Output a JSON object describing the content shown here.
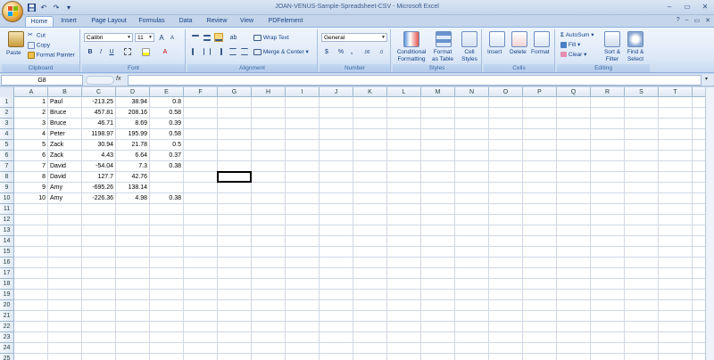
{
  "window": {
    "title": "JOAN-VENUS-Sample-Spreadsheet-CSV - Microsoft Excel",
    "minimize": "–",
    "restore": "▭",
    "close": "✕"
  },
  "qat": {
    "save_icon": "save-icon",
    "undo": "↶",
    "redo": "↷",
    "customize": "▾"
  },
  "tabs": [
    "Home",
    "Insert",
    "Page Layout",
    "Formulas",
    "Data",
    "Review",
    "View",
    "PDFelement"
  ],
  "active_tab": "Home",
  "ribbon": {
    "clipboard": {
      "paste": "Paste",
      "cut": "Cut",
      "copy": "Copy",
      "format_painter": "Format Painter",
      "label": "Clipboard"
    },
    "font": {
      "name": "Calibri",
      "size": "11",
      "grow": "A",
      "shrink": "A",
      "bold": "B",
      "italic": "I",
      "underline": "U",
      "font_color_glyph": "A",
      "label": "Font"
    },
    "alignment": {
      "wrap_text": "Wrap Text",
      "merge_center": "Merge & Center",
      "label": "Alignment"
    },
    "number": {
      "format": "General",
      "currency": "$",
      "percent": "%",
      "comma": ",",
      "inc_decimal": ".00",
      "dec_decimal": ".0",
      "label": "Number"
    },
    "styles": {
      "conditional_1": "Conditional",
      "conditional_2": "Formatting",
      "format_table_1": "Format",
      "format_table_2": "as Table",
      "cell_styles_1": "Cell",
      "cell_styles_2": "Styles",
      "label": "Styles"
    },
    "cells": {
      "insert": "Insert",
      "delete": "Delete",
      "format": "Format",
      "label": "Cells"
    },
    "editing": {
      "autosum": "AutoSum",
      "fill": "Fill",
      "clear": "Clear",
      "sort_1": "Sort &",
      "sort_2": "Filter",
      "find_1": "Find &",
      "find_2": "Select",
      "label": "Editing"
    },
    "colors": {
      "ribbon_bg": "#dce8f7",
      "accent": "#15428b",
      "group_label": "#3e6aa1"
    }
  },
  "formula_bar": {
    "name_box": "G8",
    "fx": "fx",
    "value": ""
  },
  "columns": [
    "A",
    "B",
    "C",
    "D",
    "E",
    "F",
    "G",
    "H",
    "I",
    "J",
    "K",
    "L",
    "M",
    "N",
    "O",
    "P",
    "Q",
    "R",
    "S",
    "T",
    "U"
  ],
  "rows": [
    "1",
    "2",
    "3",
    "4",
    "5",
    "6",
    "7",
    "8",
    "9",
    "10",
    "11",
    "12",
    "13",
    "14",
    "15",
    "16",
    "17",
    "18",
    "19",
    "20",
    "21",
    "22",
    "23",
    "24",
    "25"
  ],
  "sheet": {
    "data": [
      [
        "1",
        "Paul",
        "-213.25",
        "38.94",
        "0.8"
      ],
      [
        "2",
        "Bruce",
        "457.81",
        "208.16",
        "0.58"
      ],
      [
        "3",
        "Bruce",
        "46.71",
        "8.69",
        "0.39"
      ],
      [
        "4",
        "Peter",
        "1198.97",
        "195.99",
        "0.58"
      ],
      [
        "5",
        "Zack",
        "30.94",
        "21.78",
        "0.5"
      ],
      [
        "6",
        "Zack",
        "4.43",
        "6.64",
        "0.37"
      ],
      [
        "7",
        "David",
        "-54.04",
        "7.3",
        "0.38"
      ],
      [
        "8",
        "David",
        "127.7",
        "42.76",
        ""
      ],
      [
        "9",
        "Amy",
        "-695.26",
        "138.14",
        ""
      ],
      [
        "10",
        "Amy",
        "-226.36",
        "4.98",
        "0.38"
      ]
    ]
  }
}
